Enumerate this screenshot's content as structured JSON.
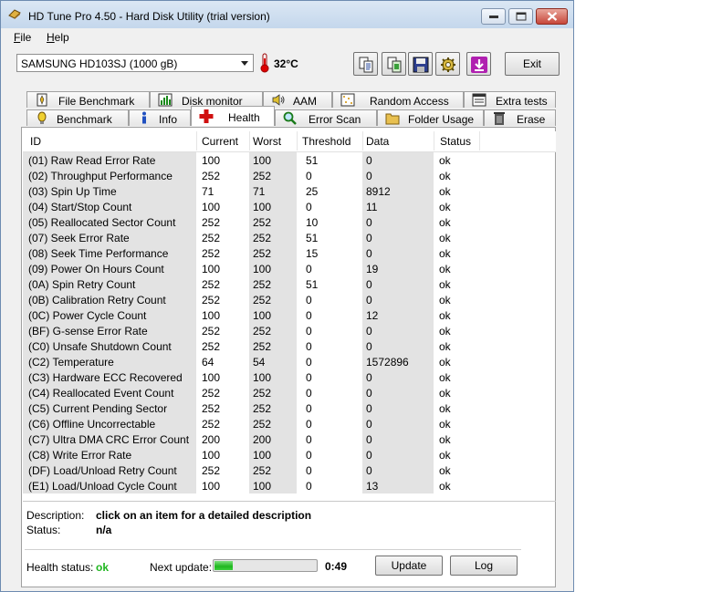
{
  "window": {
    "title": "HD Tune Pro 4.50 - Hard Disk Utility (trial version)"
  },
  "menu": {
    "items": [
      {
        "label": "File",
        "accel": "F",
        "rest": "ile"
      },
      {
        "label": "Help",
        "accel": "H",
        "rest": "elp"
      }
    ]
  },
  "toolbar": {
    "drive": "SAMSUNG HD103SJ (1000 gB)",
    "temperature": "32°C",
    "exit_label": "Exit",
    "icons": [
      "copy-text-icon",
      "copy-screenshot-icon",
      "save-icon",
      "options-icon",
      "download-icon"
    ]
  },
  "tabs": {
    "row1": [
      {
        "label": "File Benchmark",
        "icon": "file-benchmark-icon"
      },
      {
        "label": "Disk monitor",
        "icon": "disk-monitor-icon"
      },
      {
        "label": "AAM",
        "icon": "aam-speaker-icon"
      },
      {
        "label": "Random Access",
        "icon": "random-access-icon"
      },
      {
        "label": "Extra tests",
        "icon": "extra-tests-icon"
      }
    ],
    "row2": [
      {
        "label": "Benchmark",
        "icon": "benchmark-icon"
      },
      {
        "label": "Info",
        "icon": "info-icon"
      },
      {
        "label": "Health",
        "icon": "health-cross-icon",
        "active": true
      },
      {
        "label": "Error Scan",
        "icon": "error-scan-icon"
      },
      {
        "label": "Folder Usage",
        "icon": "folder-icon"
      },
      {
        "label": "Erase",
        "icon": "erase-icon"
      }
    ]
  },
  "table": {
    "columns": [
      "ID",
      "Current",
      "Worst",
      "Threshold",
      "Data",
      "Status"
    ],
    "rows": [
      [
        "(01) Raw Read Error Rate",
        "100",
        "100",
        "51",
        "0",
        "ok"
      ],
      [
        "(02) Throughput Performance",
        "252",
        "252",
        "0",
        "0",
        "ok"
      ],
      [
        "(03) Spin Up Time",
        "71",
        "71",
        "25",
        "8912",
        "ok"
      ],
      [
        "(04) Start/Stop Count",
        "100",
        "100",
        "0",
        "11",
        "ok"
      ],
      [
        "(05) Reallocated Sector Count",
        "252",
        "252",
        "10",
        "0",
        "ok"
      ],
      [
        "(07) Seek Error Rate",
        "252",
        "252",
        "51",
        "0",
        "ok"
      ],
      [
        "(08) Seek Time Performance",
        "252",
        "252",
        "15",
        "0",
        "ok"
      ],
      [
        "(09) Power On Hours Count",
        "100",
        "100",
        "0",
        "19",
        "ok"
      ],
      [
        "(0A) Spin Retry Count",
        "252",
        "252",
        "51",
        "0",
        "ok"
      ],
      [
        "(0B) Calibration Retry Count",
        "252",
        "252",
        "0",
        "0",
        "ok"
      ],
      [
        "(0C) Power Cycle Count",
        "100",
        "100",
        "0",
        "12",
        "ok"
      ],
      [
        "(BF) G-sense Error Rate",
        "252",
        "252",
        "0",
        "0",
        "ok"
      ],
      [
        "(C0) Unsafe Shutdown Count",
        "252",
        "252",
        "0",
        "0",
        "ok"
      ],
      [
        "(C2) Temperature",
        "64",
        "54",
        "0",
        "1572896",
        "ok"
      ],
      [
        "(C3) Hardware ECC Recovered",
        "100",
        "100",
        "0",
        "0",
        "ok"
      ],
      [
        "(C4) Reallocated Event Count",
        "252",
        "252",
        "0",
        "0",
        "ok"
      ],
      [
        "(C5) Current Pending Sector",
        "252",
        "252",
        "0",
        "0",
        "ok"
      ],
      [
        "(C6) Offline Uncorrectable",
        "252",
        "252",
        "0",
        "0",
        "ok"
      ],
      [
        "(C7) Ultra DMA CRC Error Count",
        "200",
        "200",
        "0",
        "0",
        "ok"
      ],
      [
        "(C8) Write Error Rate",
        "100",
        "100",
        "0",
        "0",
        "ok"
      ],
      [
        "(DF) Load/Unload Retry Count",
        "252",
        "252",
        "0",
        "0",
        "ok"
      ],
      [
        "(E1) Load/Unload Cycle Count",
        "100",
        "100",
        "0",
        "13",
        "ok"
      ]
    ]
  },
  "details": {
    "description_label": "Description:",
    "description_value": "click on an item for a detailed description",
    "status_label": "Status:",
    "status_value": "n/a"
  },
  "footer": {
    "health_label": "Health status:",
    "health_value": "ok",
    "health_color": "#1fb61f",
    "next_update_label": "Next update:",
    "progress_fraction": 0.18,
    "countdown": "0:49",
    "update_label": "Update",
    "log_label": "Log"
  }
}
